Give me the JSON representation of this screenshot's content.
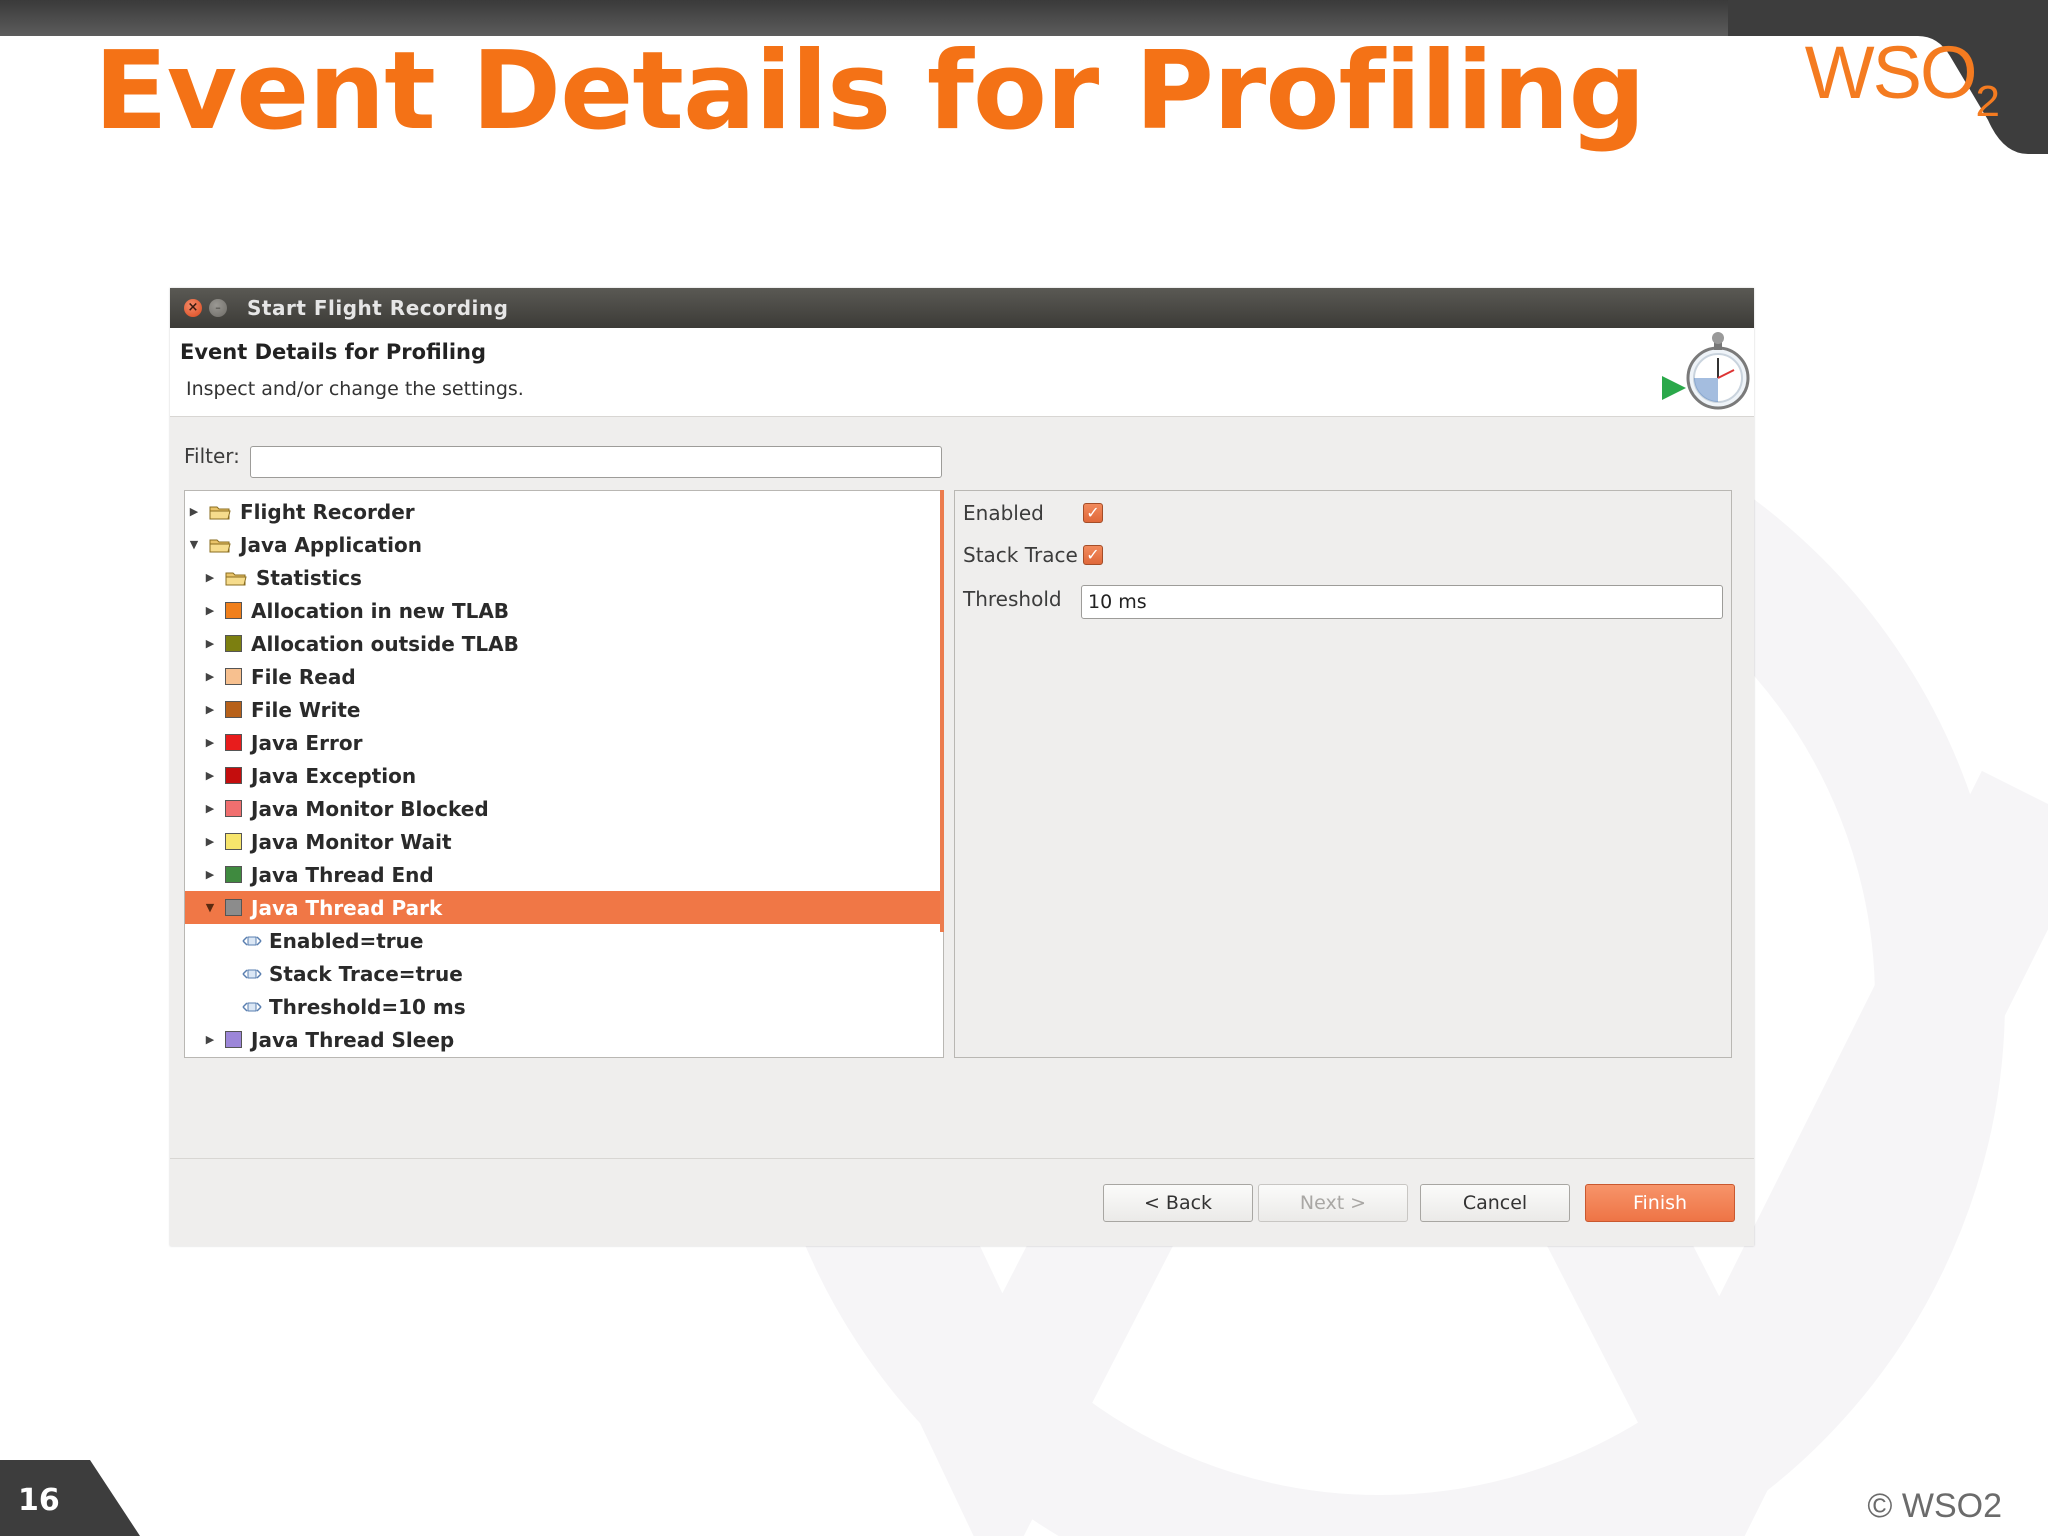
{
  "slide": {
    "title": "Event Details for Profiling",
    "page_number": "16",
    "copyright": "© WSO2",
    "logo": {
      "text": "WSO",
      "sub": "2"
    }
  },
  "dialog": {
    "window_title": "Start Flight Recording",
    "header_title": "Event Details for Profiling",
    "header_description": "Inspect and/or change the settings.",
    "header_icon": "stopwatch-play-icon",
    "filter": {
      "label": "Filter:",
      "value": "",
      "placeholder": ""
    },
    "tree": [
      {
        "label": "Flight Recorder",
        "kind": "folder",
        "expanded": false
      },
      {
        "label": "Java Application",
        "kind": "folder",
        "expanded": true
      },
      {
        "label": "Statistics",
        "kind": "folder",
        "expanded": false
      },
      {
        "label": "Allocation in new TLAB",
        "kind": "event",
        "color": "#f07f1b",
        "expanded": false
      },
      {
        "label": "Allocation outside TLAB",
        "kind": "event",
        "color": "#7c7f10",
        "expanded": false
      },
      {
        "label": "File Read",
        "kind": "event",
        "color": "#f7c08f",
        "expanded": false
      },
      {
        "label": "File Write",
        "kind": "event",
        "color": "#b7611a",
        "expanded": false
      },
      {
        "label": "Java Error",
        "kind": "event",
        "color": "#e81c1c",
        "expanded": false
      },
      {
        "label": "Java Exception",
        "kind": "event",
        "color": "#c40d0d",
        "expanded": false
      },
      {
        "label": "Java Monitor Blocked",
        "kind": "event",
        "color": "#f06f6f",
        "expanded": false
      },
      {
        "label": "Java Monitor Wait",
        "kind": "event",
        "color": "#f7e56c",
        "expanded": false
      },
      {
        "label": "Java Thread End",
        "kind": "event",
        "color": "#3f8a3f",
        "expanded": false
      },
      {
        "label": "Java Thread Park",
        "kind": "event",
        "color": "#8c8c8c",
        "expanded": true,
        "selected": true
      },
      {
        "label": "Enabled=true",
        "kind": "attribute"
      },
      {
        "label": "Stack Trace=true",
        "kind": "attribute"
      },
      {
        "label": "Threshold=10 ms",
        "kind": "attribute"
      },
      {
        "label": "Java Thread Sleep",
        "kind": "event",
        "color": "#9c86d8",
        "expanded": false
      }
    ],
    "settings": {
      "enabled_label": "Enabled",
      "enabled": true,
      "stack_trace_label": "Stack Trace",
      "stack_trace": true,
      "threshold_label": "Threshold",
      "threshold_value": "10 ms"
    },
    "buttons": {
      "back": "< Back",
      "next": "Next >",
      "cancel": "Cancel",
      "finish": "Finish"
    }
  },
  "colors": {
    "accent": "#f47216",
    "selection": "#f07746"
  }
}
